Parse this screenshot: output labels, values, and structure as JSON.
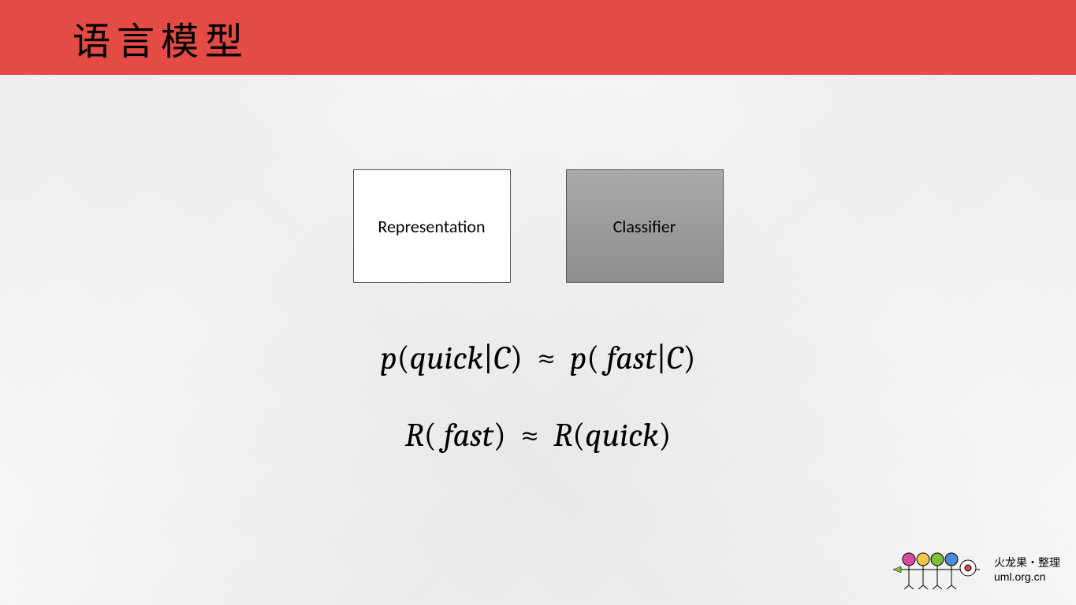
{
  "title": "语言模型",
  "boxes": {
    "representation": "Representation",
    "classifier": "Classifier"
  },
  "formulas": {
    "line1": {
      "p1": "p",
      "open1": "(",
      "arg1": "quick",
      "bar1": "|",
      "c1": "C",
      "close1": ")",
      "approx": "≈",
      "p2": "p",
      "open2": "(",
      "space2": " ",
      "arg2": "fast",
      "bar2": "|",
      "c2": "C",
      "close2": ")"
    },
    "line2": {
      "r1": "R",
      "open1": "(",
      "space1": " ",
      "arg1": "fast",
      "close1": ")",
      "approx": "≈",
      "r2": "R",
      "open2": "(",
      "arg2": "quick",
      "close2": ")"
    }
  },
  "footer": {
    "line1": "火龙果・整理",
    "line2": "uml.org.cn"
  }
}
